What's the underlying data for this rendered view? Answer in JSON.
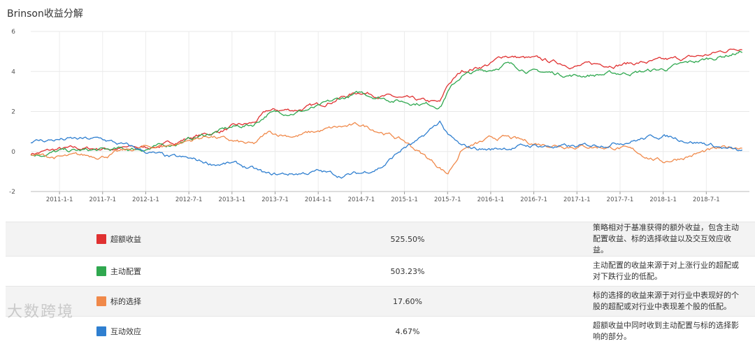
{
  "title": "Brinson收益分解",
  "chart_data": {
    "type": "line",
    "ylim": [
      -2,
      6
    ],
    "yticks": [
      "6",
      "4",
      "2",
      "0",
      "-2"
    ],
    "xticks": [
      "2011-1-1",
      "2011-7-1",
      "2012-1-1",
      "2012-7-1",
      "2013-1-1",
      "2013-7-1",
      "2014-1-1",
      "2014-7-1",
      "2015-1-1",
      "2015-7-1",
      "2016-1-1",
      "2016-7-1",
      "2017-1-1",
      "2017-7-1",
      "2018-1-1",
      "2018-7-1"
    ],
    "grid": true,
    "series": [
      {
        "name": "超额收益",
        "color": "#e03131",
        "points": [
          [
            "2010-9",
            -0.1
          ],
          [
            "2011-1",
            0.1
          ],
          [
            "2011-7",
            0.15
          ],
          [
            "2012-1",
            0.2
          ],
          [
            "2012-4",
            0.35
          ],
          [
            "2012-7",
            0.7
          ],
          [
            "2012-10",
            0.9
          ],
          [
            "2013-1",
            1.2
          ],
          [
            "2013-4",
            1.4
          ],
          [
            "2013-6",
            2.0
          ],
          [
            "2013-10",
            2.1
          ],
          [
            "2014-1",
            2.3
          ],
          [
            "2014-4",
            2.7
          ],
          [
            "2014-7",
            3.0
          ],
          [
            "2014-10",
            2.8
          ],
          [
            "2015-1",
            2.6
          ],
          [
            "2015-3",
            2.5
          ],
          [
            "2015-6",
            2.4
          ],
          [
            "2015-7",
            3.3
          ],
          [
            "2015-9",
            4.0
          ],
          [
            "2016-1",
            4.4
          ],
          [
            "2016-3",
            4.8
          ],
          [
            "2016-7",
            4.6
          ],
          [
            "2017-1",
            4.3
          ],
          [
            "2017-7",
            4.4
          ],
          [
            "2018-1",
            4.5
          ],
          [
            "2018-7",
            4.8
          ],
          [
            "2018-12",
            5.25
          ]
        ]
      },
      {
        "name": "主动配置",
        "color": "#2fa84f",
        "points": [
          [
            "2010-9",
            -0.2
          ],
          [
            "2011-1",
            0.0
          ],
          [
            "2011-7",
            0.05
          ],
          [
            "2012-1",
            0.15
          ],
          [
            "2012-4",
            0.3
          ],
          [
            "2012-7",
            0.6
          ],
          [
            "2012-10",
            0.9
          ],
          [
            "2013-1",
            1.2
          ],
          [
            "2013-4",
            1.35
          ],
          [
            "2013-6",
            1.9
          ],
          [
            "2013-10",
            2.0
          ],
          [
            "2014-1",
            2.2
          ],
          [
            "2014-4",
            2.6
          ],
          [
            "2014-7",
            2.9
          ],
          [
            "2014-10",
            2.7
          ],
          [
            "2015-1",
            2.5
          ],
          [
            "2015-3",
            2.45
          ],
          [
            "2015-6",
            2.3
          ],
          [
            "2015-7",
            3.0
          ],
          [
            "2015-9",
            3.8
          ],
          [
            "2016-1",
            4.1
          ],
          [
            "2016-3",
            4.4
          ],
          [
            "2016-7",
            4.0
          ],
          [
            "2017-1",
            3.8
          ],
          [
            "2017-7",
            3.9
          ],
          [
            "2018-1",
            4.1
          ],
          [
            "2018-7",
            4.6
          ],
          [
            "2018-12",
            5.0
          ]
        ]
      },
      {
        "name": "标的选择",
        "color": "#f0894a",
        "points": [
          [
            "2010-9",
            -0.2
          ],
          [
            "2011-1",
            -0.3
          ],
          [
            "2011-7",
            -0.2
          ],
          [
            "2012-1",
            0.2
          ],
          [
            "2012-4",
            0.3
          ],
          [
            "2012-7",
            0.55
          ],
          [
            "2012-10",
            0.8
          ],
          [
            "2013-1",
            0.5
          ],
          [
            "2013-4",
            0.3
          ],
          [
            "2013-6",
            0.9
          ],
          [
            "2013-10",
            0.8
          ],
          [
            "2014-1",
            1.0
          ],
          [
            "2014-4",
            1.2
          ],
          [
            "2014-7",
            1.3
          ],
          [
            "2014-10",
            1.0
          ],
          [
            "2015-1",
            0.5
          ],
          [
            "2015-3",
            0.0
          ],
          [
            "2015-6",
            -0.8
          ],
          [
            "2015-7",
            -1.1
          ],
          [
            "2015-9",
            0.1
          ],
          [
            "2016-1",
            0.6
          ],
          [
            "2016-3",
            0.7
          ],
          [
            "2016-7",
            0.4
          ],
          [
            "2017-1",
            0.3
          ],
          [
            "2017-7",
            0.2
          ],
          [
            "2018-1",
            -0.5
          ],
          [
            "2018-7",
            0.0
          ],
          [
            "2018-12",
            0.25
          ]
        ]
      },
      {
        "name": "互动效应",
        "color": "#2f7fd0",
        "points": [
          [
            "2010-9",
            0.5
          ],
          [
            "2011-1",
            0.6
          ],
          [
            "2011-7",
            0.6
          ],
          [
            "2012-1",
            0.0
          ],
          [
            "2012-4",
            -0.3
          ],
          [
            "2012-7",
            -0.4
          ],
          [
            "2012-10",
            -0.6
          ],
          [
            "2013-1",
            -0.6
          ],
          [
            "2013-4",
            -0.9
          ],
          [
            "2013-6",
            -1.2
          ],
          [
            "2013-10",
            -1.1
          ],
          [
            "2014-1",
            -1.0
          ],
          [
            "2014-4",
            -1.2
          ],
          [
            "2014-7",
            -1.1
          ],
          [
            "2014-10",
            -0.7
          ],
          [
            "2015-1",
            0.2
          ],
          [
            "2015-3",
            0.5
          ],
          [
            "2015-6",
            1.5
          ],
          [
            "2015-7",
            0.8
          ],
          [
            "2015-9",
            0.2
          ],
          [
            "2016-1",
            0.1
          ],
          [
            "2016-3",
            0.2
          ],
          [
            "2016-7",
            0.3
          ],
          [
            "2017-1",
            0.2
          ],
          [
            "2017-7",
            0.5
          ],
          [
            "2018-1",
            0.8
          ],
          [
            "2018-7",
            0.4
          ],
          [
            "2018-12",
            -0.05
          ]
        ]
      }
    ]
  },
  "table": [
    {
      "name": "超额收益",
      "color": "#e03131",
      "value": "525.50%",
      "desc": "策略相对于基准获得的额外收益，包含主动配置收益、标的选择收益以及交互效应收益。"
    },
    {
      "name": "主动配置",
      "color": "#2fa84f",
      "value": "503.23%",
      "desc": "主动配置的收益来源于对上涨行业的超配或对下跌行业的低配。"
    },
    {
      "name": "标的选择",
      "color": "#f0894a",
      "value": "17.60%",
      "desc": "标的选择的收益来源于对行业中表现好的个股的超配或对行业中表现差个股的低配。"
    },
    {
      "name": "互动效应",
      "color": "#2f7fd0",
      "value": "4.67%",
      "desc": "超额收益中同时收到主动配置与标的选择影响的部分。"
    }
  ],
  "watermark": "大数跨境"
}
